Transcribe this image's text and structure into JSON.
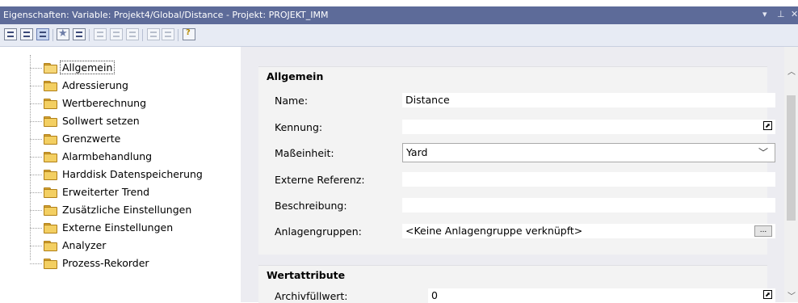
{
  "window": {
    "title": "Eigenschaften: Variable: Projekt4/Global/Distance - Projekt: PROJEKT_IMM",
    "controls": {
      "dropdown": "▾",
      "pin": "⊥",
      "close": "✕"
    }
  },
  "tree": {
    "items": [
      {
        "label": "Allgemein",
        "icon": "folder-open-icon"
      },
      {
        "label": "Adressierung",
        "icon": "folder-icon"
      },
      {
        "label": "Wertberechnung",
        "icon": "folder-icon"
      },
      {
        "label": "Sollwert setzen",
        "icon": "folder-icon"
      },
      {
        "label": "Grenzwerte",
        "icon": "folder-icon"
      },
      {
        "label": "Alarmbehandlung",
        "icon": "folder-icon"
      },
      {
        "label": "Harddisk Datenspeicherung",
        "icon": "folder-icon"
      },
      {
        "label": "Erweiterter Trend",
        "icon": "folder-icon"
      },
      {
        "label": "Zusätzliche Einstellungen",
        "icon": "folder-icon"
      },
      {
        "label": "Externe Einstellungen",
        "icon": "folder-icon"
      },
      {
        "label": "Analyzer",
        "icon": "folder-icon"
      },
      {
        "label": "Prozess-Rekorder",
        "icon": "folder-icon"
      }
    ],
    "selected": "Allgemein"
  },
  "general": {
    "title": "Allgemein",
    "name_label": "Name:",
    "name_value": "Distance",
    "kennung_label": "Kennung:",
    "kennung_value": "",
    "unit_label": "Maßeinheit:",
    "unit_value": "Yard",
    "extref_label": "Externe Referenz:",
    "extref_value": "",
    "desc_label": "Beschreibung:",
    "desc_value": "",
    "groups_label": "Anlagengruppen:",
    "groups_value": "<Keine Anlagengruppe verknüpft>",
    "browse_label": "..."
  },
  "value_attributes": {
    "title": "Wertattribute",
    "archive_label": "Archivfüllwert:",
    "archive_value": "0"
  },
  "colors": {
    "titlebar": "#5d6b99",
    "toolbar": "#e7ebf4",
    "panel": "#ececf1",
    "folder": "#f3cf62"
  }
}
